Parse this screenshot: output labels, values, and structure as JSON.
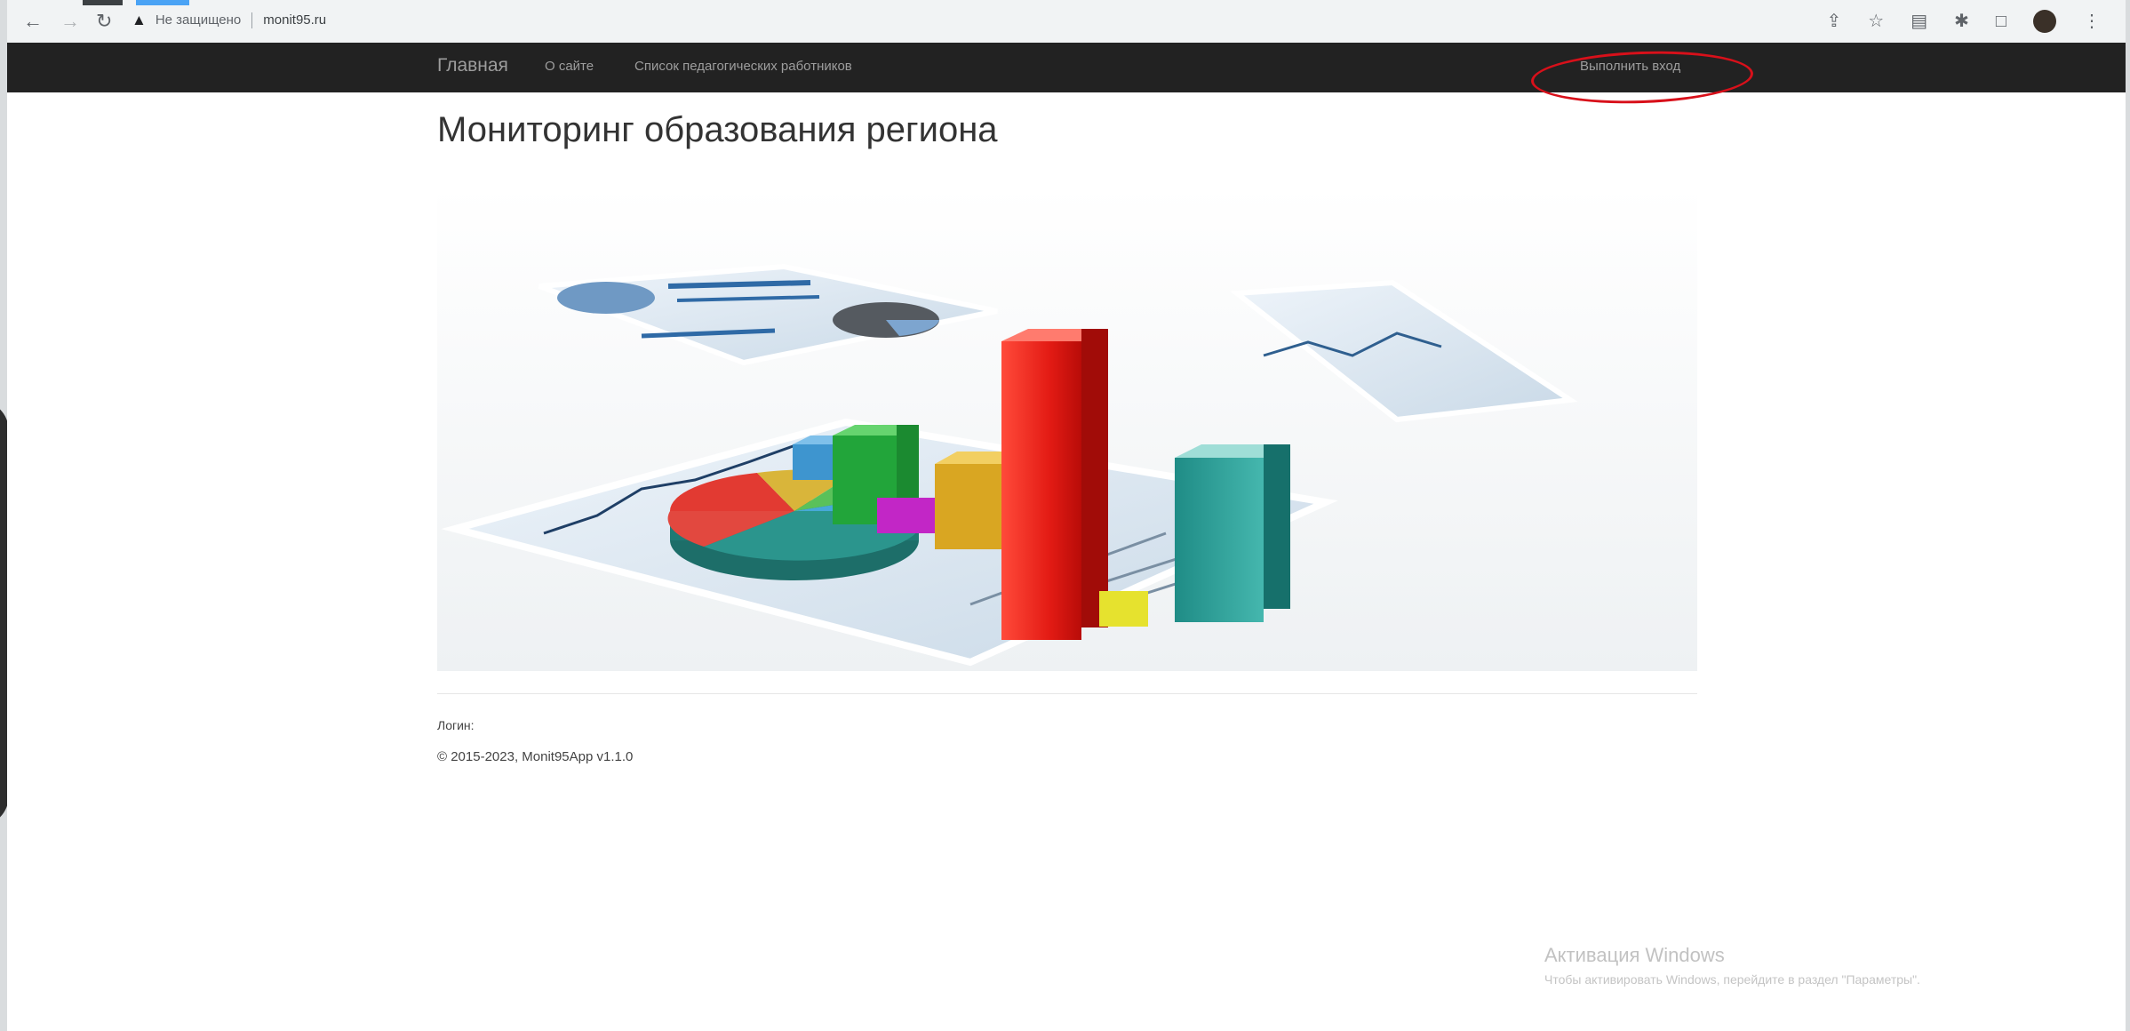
{
  "browser": {
    "security_label": "Не защищено",
    "url": "monit95.ru",
    "icons": [
      "back-icon",
      "forward-icon",
      "reload-icon",
      "warning-icon",
      "share-icon",
      "star-icon",
      "reading-list-icon",
      "extensions-icon",
      "window-icon",
      "profile-icon",
      "menu-icon"
    ]
  },
  "nav": {
    "brand": "Главная",
    "links": [
      "О сайте",
      "Список педагогических работников"
    ],
    "login": "Выполнить вход",
    "highlight_color": "#d8101a"
  },
  "page": {
    "title": "Мониторинг образования региона"
  },
  "footer": {
    "login_label": "Логин:",
    "copyright": "© 2015-2023, Monit95App v1.1.0"
  },
  "windows_watermark": {
    "title": "Активация Windows",
    "subtitle": "Чтобы активировать Windows, перейдите в раздел \"Параметры\"."
  },
  "colors": {
    "navbar_bg": "#222222",
    "nav_text": "#9d9d9d"
  }
}
